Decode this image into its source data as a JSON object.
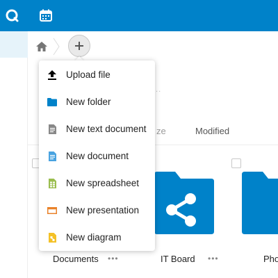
{
  "topbar": {
    "apps": [
      {
        "name": "files",
        "icon": "files-app-icon"
      },
      {
        "name": "calendar",
        "icon": "calendar-app-icon"
      }
    ],
    "color": "#0082c9"
  },
  "breadcrumb": {
    "home_icon": "home-icon",
    "add_icon": "plus-icon"
  },
  "columns": {
    "size": "ze",
    "modified": "Modified"
  },
  "menu": {
    "items": [
      {
        "label": "Upload file",
        "icon": "upload-icon",
        "color": "#000000"
      },
      {
        "label": "New folder",
        "icon": "folder-icon",
        "color": "#0082c9"
      },
      {
        "label": "New text document",
        "icon": "text-document-icon",
        "color": "#888888"
      },
      {
        "label": "New document",
        "icon": "document-icon",
        "color": "#49a3e0"
      },
      {
        "label": "New spreadsheet",
        "icon": "spreadsheet-icon",
        "color": "#9abd4e"
      },
      {
        "label": "New presentation",
        "icon": "presentation-icon",
        "color": "#e9822a"
      },
      {
        "label": "New diagram",
        "icon": "diagram-icon",
        "color": "#f4c127"
      }
    ]
  },
  "files": [
    {
      "name": "Documents",
      "more": "•••"
    },
    {
      "name": "IT Board",
      "more": "•••",
      "icon": "share-icon"
    },
    {
      "name": "Pho"
    }
  ],
  "faded_more": "..."
}
